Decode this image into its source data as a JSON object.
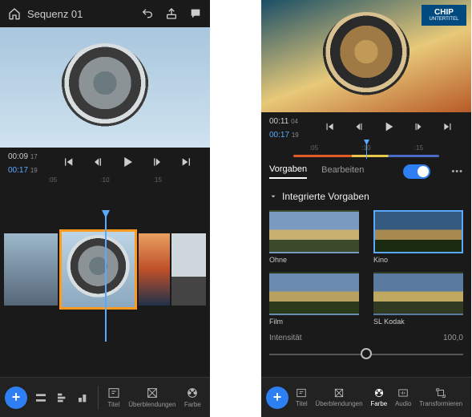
{
  "left": {
    "header": {
      "title": "Sequenz 01"
    },
    "timecode": {
      "current": "00:09",
      "currentFrame": "17",
      "duration": "00:17",
      "durationFrame": "19"
    },
    "ruler": {
      "t1": ":05",
      "t2": ":10",
      "t3": ":15"
    },
    "bottom": {
      "items": [
        {
          "label": "Titel"
        },
        {
          "label": "Überblendungen"
        },
        {
          "label": "Farbe"
        }
      ]
    }
  },
  "right": {
    "chip": {
      "main": "CHIP",
      "sub": "UNTERTITEL"
    },
    "timecode": {
      "current": "00:11",
      "currentFrame": "04",
      "duration": "00:17",
      "durationFrame": "19"
    },
    "ruler": {
      "t1": ":05",
      "t2": ":10",
      "t3": ":15"
    },
    "tabs": {
      "active": "Vorgaben",
      "other": "Bearbeiten"
    },
    "section": "Integrierte Vorgaben",
    "presets": {
      "p1": "Ohne",
      "p2": "Kino",
      "p3": "Film",
      "p4": "SL Kodak"
    },
    "intensity": {
      "label": "Intensität",
      "value": "100,0"
    },
    "bottom": {
      "items": [
        {
          "label": "Titel"
        },
        {
          "label": "Überblendungen"
        },
        {
          "label": "Farbe"
        },
        {
          "label": "Audio"
        },
        {
          "label": "Transformieren"
        }
      ]
    }
  }
}
